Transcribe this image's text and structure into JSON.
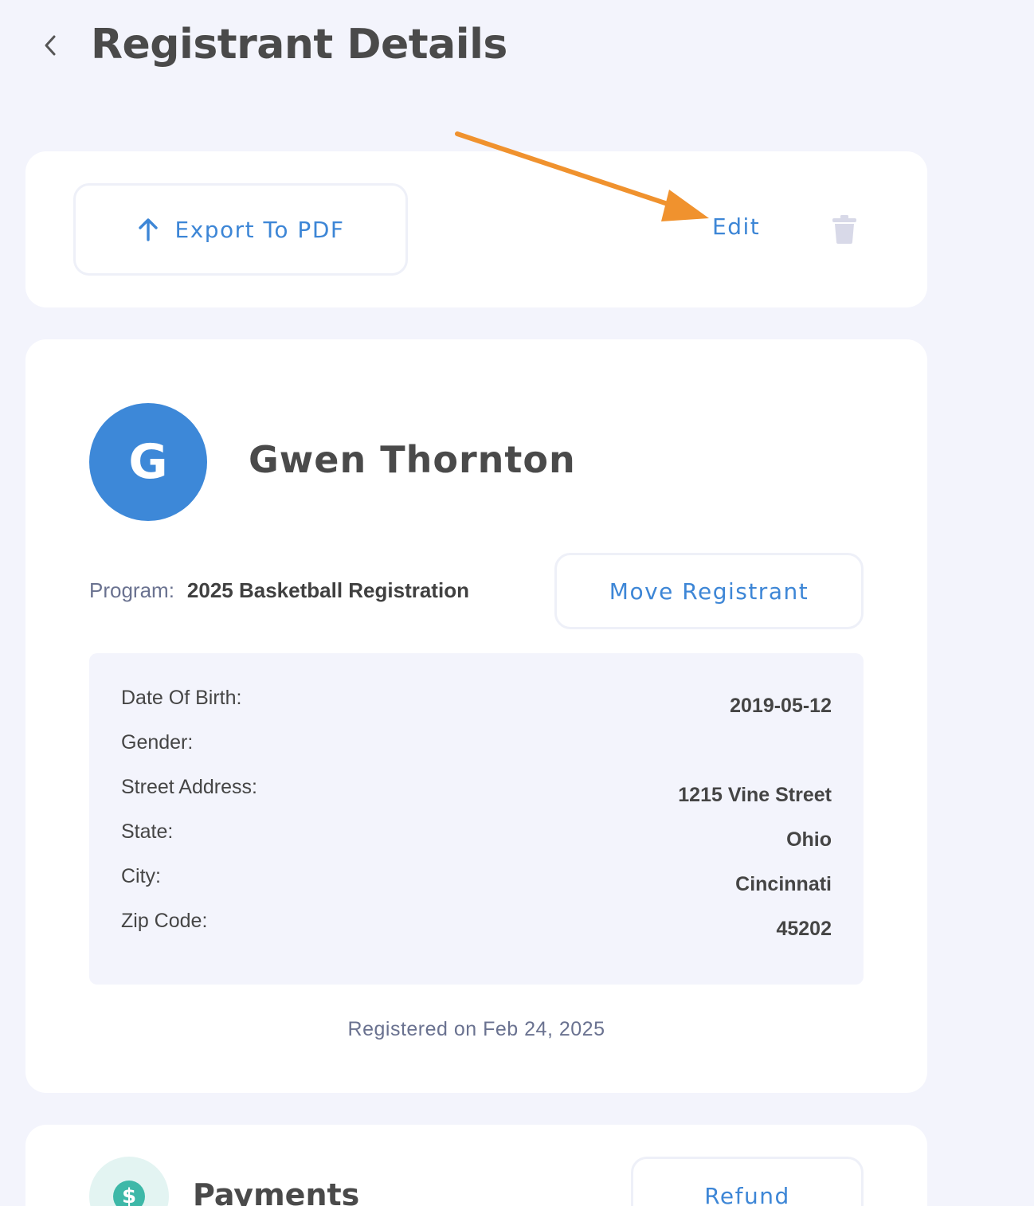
{
  "header": {
    "title": "Registrant Details",
    "back_icon": "chevron-left-icon"
  },
  "toolbar": {
    "export_label": "Export To PDF",
    "export_icon": "arrow-up-icon",
    "edit_label": "Edit",
    "delete_icon": "trash-icon"
  },
  "profile": {
    "avatar_initial": "G",
    "name": "Gwen Thornton",
    "program_label": "Program:",
    "program_value": "2025 Basketball Registration",
    "move_label": "Move Registrant",
    "details": [
      {
        "label": "Date Of Birth:",
        "value": "2019-05-12"
      },
      {
        "label": "Gender:",
        "value": ""
      },
      {
        "label": "Street Address:",
        "value": "1215 Vine Street"
      },
      {
        "label": "State:",
        "value": "Ohio"
      },
      {
        "label": "City:",
        "value": "Cincinnati"
      },
      {
        "label": "Zip Code:",
        "value": "45202"
      }
    ],
    "registered_text": "Registered on Feb 24, 2025"
  },
  "payments": {
    "title": "Payments",
    "icon": "dollar-icon",
    "icon_glyph": "$",
    "refund_label": "Refund"
  },
  "colors": {
    "accent": "#3d86d6",
    "avatar": "#3d88d8",
    "annotation_arrow": "#f0922e",
    "background": "#f3f4fc"
  }
}
